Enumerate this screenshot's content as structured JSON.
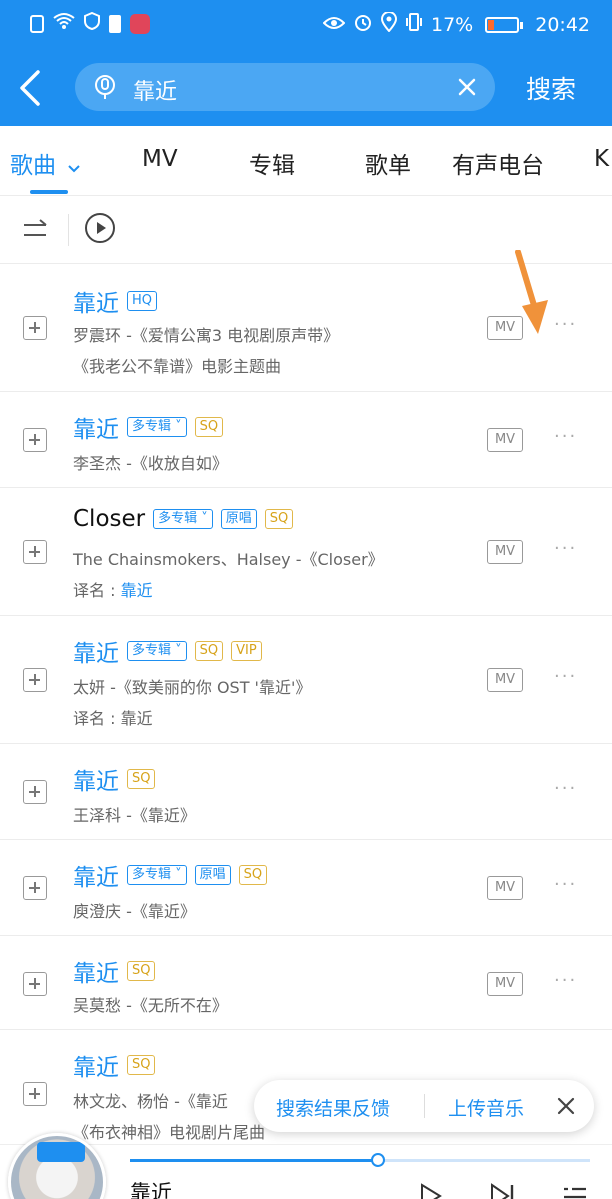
{
  "status": {
    "battery": "17%",
    "time": "20:42"
  },
  "search": {
    "query": "靠近",
    "button_label": "搜索"
  },
  "tabs": [
    {
      "label": "歌曲"
    },
    {
      "label": "MV"
    },
    {
      "label": "专辑"
    },
    {
      "label": "歌单"
    },
    {
      "label": "有声电台"
    },
    {
      "label": "K"
    }
  ],
  "badges": {
    "hq": "HQ",
    "sq": "SQ",
    "vip": "VIP",
    "orig": "原唱",
    "multi": "多专辑"
  },
  "mv_label": "MV",
  "more_label": "···",
  "songs": [
    {
      "title": "靠近",
      "line1": "罗震环 -《爱情公寓3 电视剧原声带》",
      "line2": "《我老公不靠谱》电影主题曲"
    },
    {
      "title": "靠近",
      "line1": "李圣杰 -《收放自如》"
    },
    {
      "title": "Closer",
      "line1": "The Chainsmokers、Halsey -《Closer》",
      "line2_prefix": "译名 : ",
      "line2_value": "靠近"
    },
    {
      "title": "靠近",
      "line1": "太妍 -《致美丽的你 OST '靠近'》",
      "line2": "译名 : 靠近"
    },
    {
      "title": "靠近",
      "line1": "王泽科 -《靠近》"
    },
    {
      "title": "靠近",
      "line1": "庾澄庆 -《靠近》"
    },
    {
      "title": "靠近",
      "line1": "吴莫愁 -《无所不在》"
    },
    {
      "title": "靠近",
      "line1": "林文龙、杨怡 -《靠近",
      "line2": "《布衣神相》电视剧片尾曲"
    }
  ],
  "feedback": {
    "left": "搜索结果反馈",
    "right": "上传音乐"
  },
  "player": {
    "title": "靠近",
    "progress": 0.54
  },
  "colors": {
    "accent": "#1e8ff0",
    "sq": "#d7a31a",
    "annotation_arrow": "#f0923a"
  }
}
